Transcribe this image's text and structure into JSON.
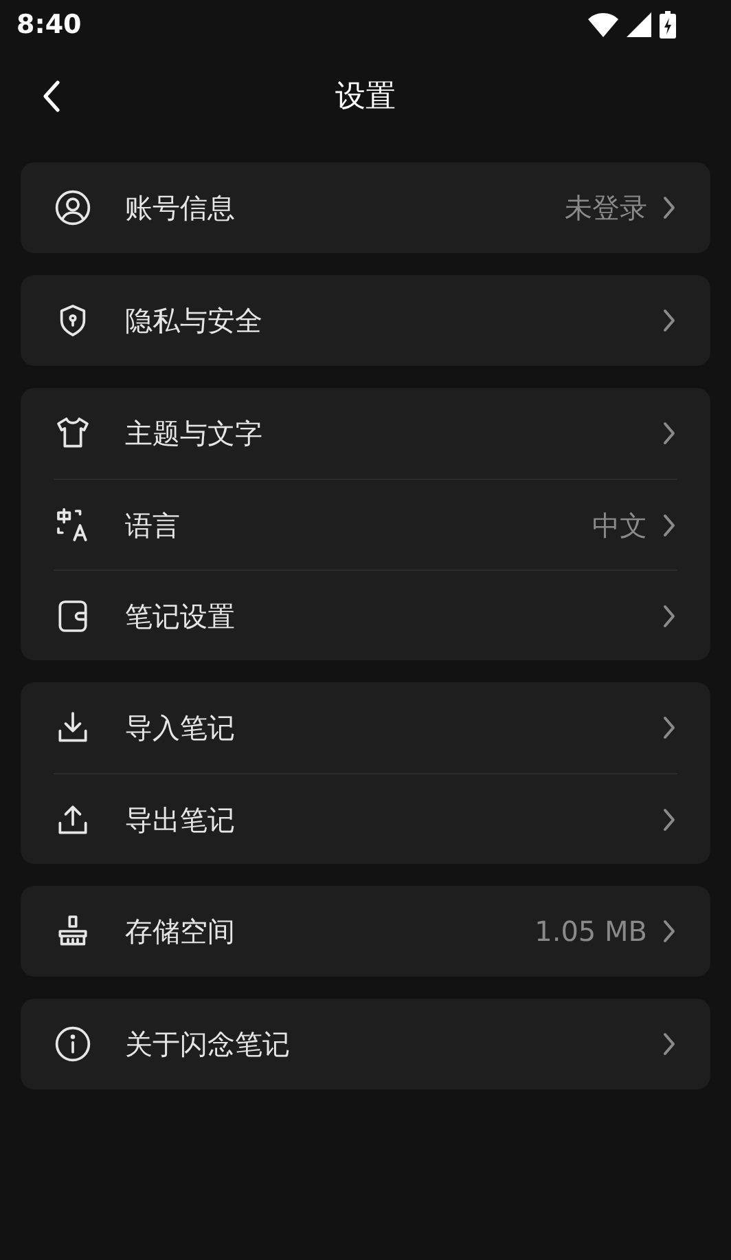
{
  "status_bar": {
    "time": "8:40"
  },
  "header": {
    "title": "设置"
  },
  "groups": [
    {
      "rows": [
        {
          "label": "账号信息",
          "value": "未登录"
        }
      ]
    },
    {
      "rows": [
        {
          "label": "隐私与安全"
        }
      ]
    },
    {
      "rows": [
        {
          "label": "主题与文字"
        },
        {
          "label": "语言",
          "value": "中文"
        },
        {
          "label": "笔记设置"
        }
      ]
    },
    {
      "rows": [
        {
          "label": "导入笔记"
        },
        {
          "label": "导出笔记"
        }
      ]
    },
    {
      "rows": [
        {
          "label": "存储空间",
          "value": "1.05 MB"
        }
      ]
    },
    {
      "rows": [
        {
          "label": "关于闪念笔记"
        }
      ]
    }
  ]
}
